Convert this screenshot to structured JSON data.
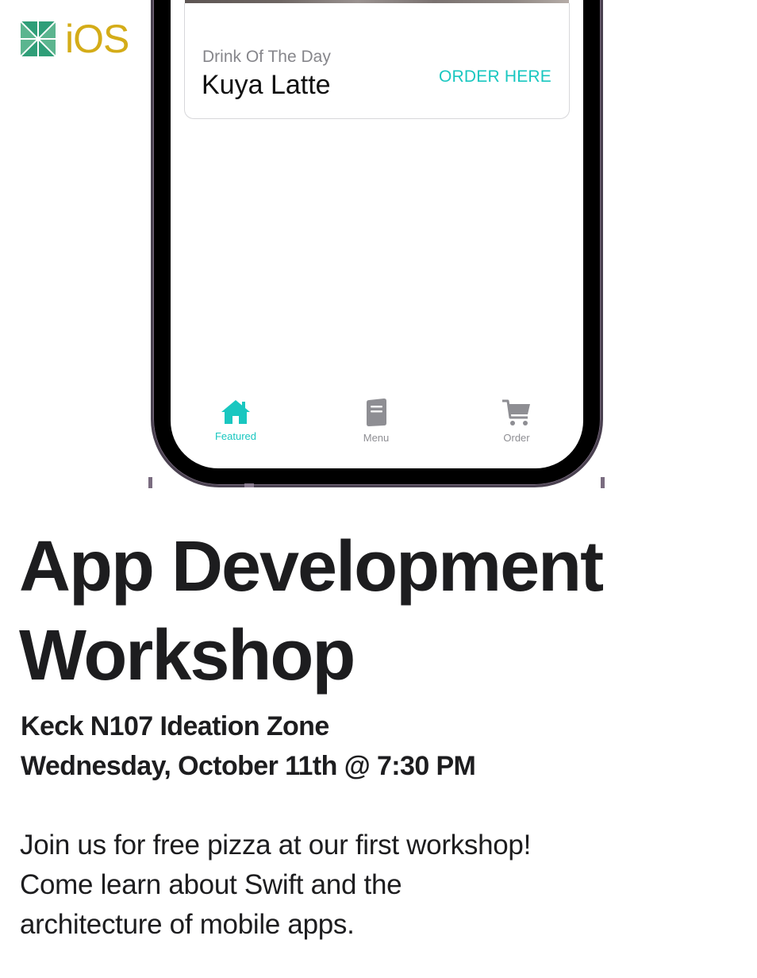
{
  "logo": {
    "text": "iOS",
    "brand_color": "#d4ac18",
    "mark_colors": [
      "#2f9e78",
      "#7cc7a6"
    ]
  },
  "phone_screen": {
    "drink_card": {
      "kicker": "Drink Of The Day",
      "name": "Kuya Latte",
      "action_label": "ORDER HERE",
      "accent_color": "#19c7c0"
    },
    "tabs": [
      {
        "label": "Featured",
        "icon": "house-icon",
        "active": true
      },
      {
        "label": "Menu",
        "icon": "book-icon",
        "active": false
      },
      {
        "label": "Order",
        "icon": "cart-icon",
        "active": false
      }
    ]
  },
  "poster": {
    "title_line1": "App Development",
    "title_line2": "Workshop",
    "location": "Keck N107 Ideation Zone",
    "datetime": "Wednesday, October 11th @ 7:30 PM",
    "blurb_line1": "Join us for free pizza at our first workshop!",
    "blurb_line2": "Come learn about Swift and the",
    "blurb_line3": "architecture of mobile apps."
  }
}
